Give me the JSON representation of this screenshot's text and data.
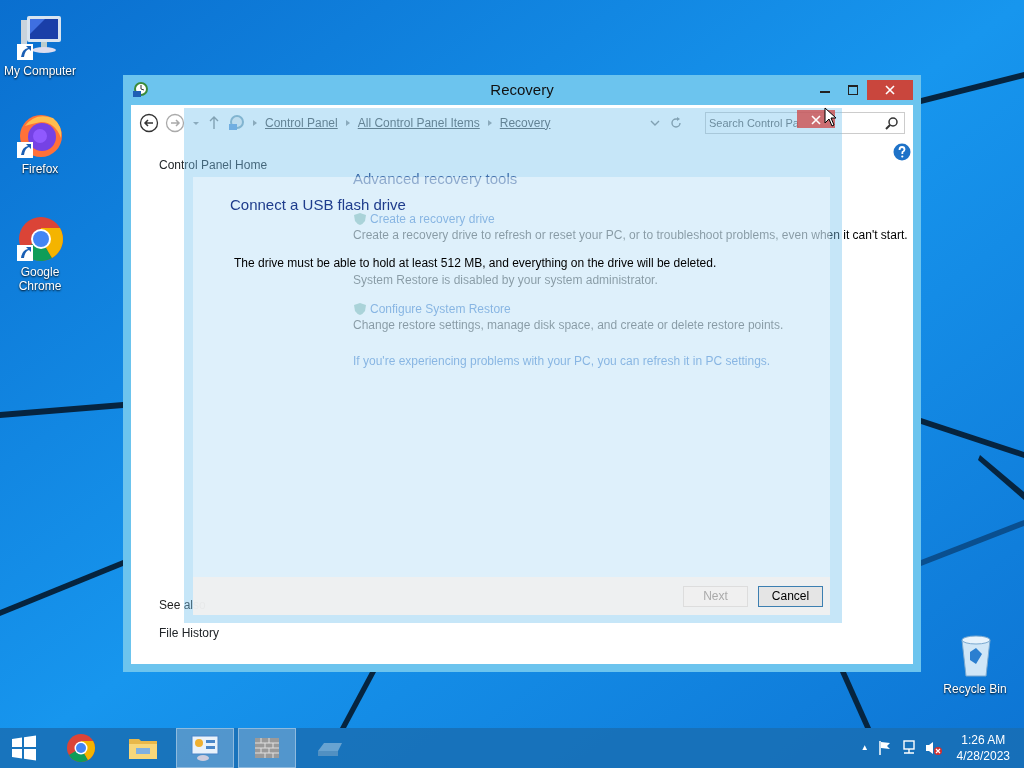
{
  "desktop_icons": [
    {
      "label": "My Computer",
      "kind": "computer"
    },
    {
      "label": "Firefox",
      "kind": "firefox"
    },
    {
      "label": "Google Chrome",
      "kind": "chrome"
    },
    {
      "label": "Recycle Bin",
      "kind": "recycle"
    }
  ],
  "window": {
    "title": "Recovery",
    "breadcrumbs": [
      "Control Panel",
      "All Control Panel Items",
      "Recovery"
    ],
    "search": {
      "placeholder": "Search Control Pa"
    },
    "sidebar": {
      "links": [
        "Control Panel Home"
      ],
      "see_also_heading": "See also",
      "see_also": [
        "File History"
      ]
    },
    "main": {
      "heading": "Advanced recovery tools",
      "tools": [
        {
          "title": "Create a recovery drive",
          "description": "Create a recovery drive to refresh or reset your PC, or to troubleshoot problems, even when it can't start."
        },
        {
          "description": "System Restore is disabled by your system administrator."
        },
        {
          "title": "Configure System Restore",
          "description": "Change restore settings, manage disk space, and create or delete restore points."
        }
      ],
      "footer_link": "If you're experiencing problems with your PC, you can refresh it in PC settings."
    }
  },
  "dialog": {
    "heading": "Connect a USB flash drive",
    "message": "The drive must be able to hold at least 512 MB, and everything on the drive will be deleted.",
    "buttons": [
      {
        "label": "Next",
        "disabled": true
      },
      {
        "label": "Cancel",
        "disabled": false
      }
    ]
  },
  "taskbar": {
    "apps": [
      {
        "kind": "chrome",
        "highlighted": false
      },
      {
        "kind": "explorer",
        "highlighted": false
      },
      {
        "kind": "control-panel",
        "highlighted": true
      },
      {
        "kind": "firewall",
        "highlighted": true
      },
      {
        "kind": "drive",
        "highlighted": false
      }
    ],
    "tray_arrow": "▲",
    "clock": {
      "time": "1:26 AM",
      "date": "4/28/2023"
    }
  }
}
